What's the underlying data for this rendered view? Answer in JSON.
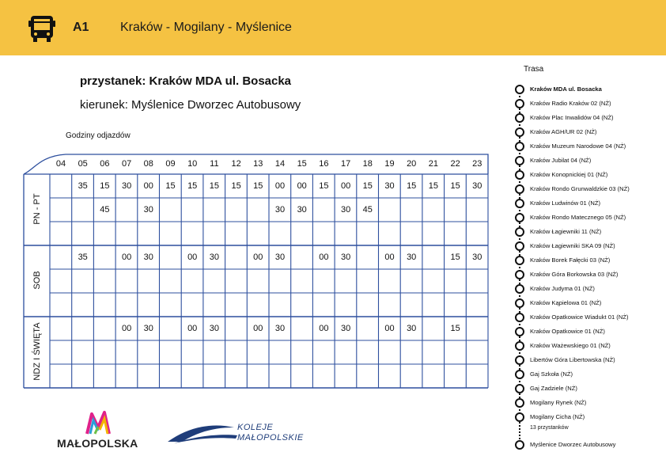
{
  "header": {
    "route_code": "A1",
    "route_name": "Kraków - Mogilany - Myślenice"
  },
  "stop_title": "przystanek: Kraków MDA ul. Bosacka",
  "direction": "kierunek: Myślenice Dworzec Autobusowy",
  "hours_caption": "Godziny odjazdów",
  "hours": [
    "04",
    "05",
    "06",
    "07",
    "08",
    "09",
    "10",
    "11",
    "12",
    "13",
    "14",
    "15",
    "16",
    "17",
    "18",
    "19",
    "20",
    "21",
    "22",
    "23"
  ],
  "days": [
    {
      "label": "PN - PT",
      "rows": [
        [
          "",
          "35",
          "15",
          "30",
          "00",
          "15",
          "15",
          "15",
          "15",
          "15",
          "00",
          "00",
          "15",
          "00",
          "15",
          "30",
          "15",
          "15",
          "15",
          "30"
        ],
        [
          "",
          "",
          "45",
          "",
          "30",
          "",
          "",
          "",
          "",
          "",
          "30",
          "30",
          "",
          "30",
          "45",
          "",
          "",
          "",
          "",
          ""
        ],
        [
          "",
          "",
          "",
          "",
          "",
          "",
          "",
          "",
          "",
          "",
          "",
          "",
          "",
          "",
          "",
          "",
          "",
          "",
          "",
          ""
        ]
      ]
    },
    {
      "label": "SOB",
      "rows": [
        [
          "",
          "35",
          "",
          "00",
          "30",
          "",
          "00",
          "30",
          "",
          "00",
          "30",
          "",
          "00",
          "30",
          "",
          "00",
          "30",
          "",
          "15",
          "30"
        ],
        [
          "",
          "",
          "",
          "",
          "",
          "",
          "",
          "",
          "",
          "",
          "",
          "",
          "",
          "",
          "",
          "",
          "",
          "",
          "",
          ""
        ],
        [
          "",
          "",
          "",
          "",
          "",
          "",
          "",
          "",
          "",
          "",
          "",
          "",
          "",
          "",
          "",
          "",
          "",
          "",
          "",
          ""
        ]
      ]
    },
    {
      "label": "NDZ I ŚWIĘTA",
      "rows": [
        [
          "",
          "",
          "",
          "00",
          "30",
          "",
          "00",
          "30",
          "",
          "00",
          "30",
          "",
          "00",
          "30",
          "",
          "00",
          "30",
          "",
          "15",
          ""
        ],
        [
          "",
          "",
          "",
          "",
          "",
          "",
          "",
          "",
          "",
          "",
          "",
          "",
          "",
          "",
          "",
          "",
          "",
          "",
          "",
          ""
        ],
        [
          "",
          "",
          "",
          "",
          "",
          "",
          "",
          "",
          "",
          "",
          "",
          "",
          "",
          "",
          "",
          "",
          "",
          "",
          "",
          ""
        ]
      ]
    }
  ],
  "logos": {
    "malopolska": "MAŁOPOLSKA",
    "koleje_line1": "KOLEJE",
    "koleje_line2": "MAŁOPOLSKIE"
  },
  "route_list": {
    "title": "Trasa",
    "stops": [
      {
        "name": "Kraków MDA ul. Bosacka",
        "current": true
      },
      {
        "name": "Kraków Radio Kraków 02 (NŻ)"
      },
      {
        "name": "Kraków Plac Inwalidów 04 (NŻ)"
      },
      {
        "name": "Kraków AGH/UR 02 (NŻ)"
      },
      {
        "name": "Kraków Muzeum Narodowe 04 (NŻ)"
      },
      {
        "name": "Kraków Jubilat 04 (NŻ)"
      },
      {
        "name": "Kraków Konopnickiej 01 (NŻ)"
      },
      {
        "name": "Kraków Rondo Grunwaldzkie 03 (NŻ)"
      },
      {
        "name": "Kraków Ludwinów 01 (NŻ)"
      },
      {
        "name": "Kraków Rondo Matecznego 05 (NŻ)"
      },
      {
        "name": "Kraków Łagiewniki 11 (NŻ)"
      },
      {
        "name": "Kraków Łagiewniki SKA 09 (NŻ)"
      },
      {
        "name": "Kraków Borek Fałęcki 03 (NŻ)"
      },
      {
        "name": "Kraków Góra Borkowska 03 (NŻ)"
      },
      {
        "name": "Kraków Judyma 01 (NŻ)"
      },
      {
        "name": "Kraków Kąpielowa 01 (NŻ)"
      },
      {
        "name": "Kraków Opatkowice Wiadukt 01 (NŻ)"
      },
      {
        "name": "Kraków Opatkowice 01 (NŻ)"
      },
      {
        "name": "Kraków Ważewskiego 01 (NŻ)"
      },
      {
        "name": "Libertów Góra Libertowska (NŻ)"
      },
      {
        "name": "Gaj Szkoła (NŻ)"
      },
      {
        "name": "Gaj Zadziele (NŻ)"
      },
      {
        "name": "Mogilany Rynek (NŻ)"
      },
      {
        "name": "Mogilany Cicha (NŻ)"
      }
    ],
    "more_text": "13 przystanków",
    "last_stop": "Myślenice Dworzec Autobusowy"
  },
  "colors": {
    "header_bg": "#F5C242",
    "grid": "#2D4F9E"
  }
}
